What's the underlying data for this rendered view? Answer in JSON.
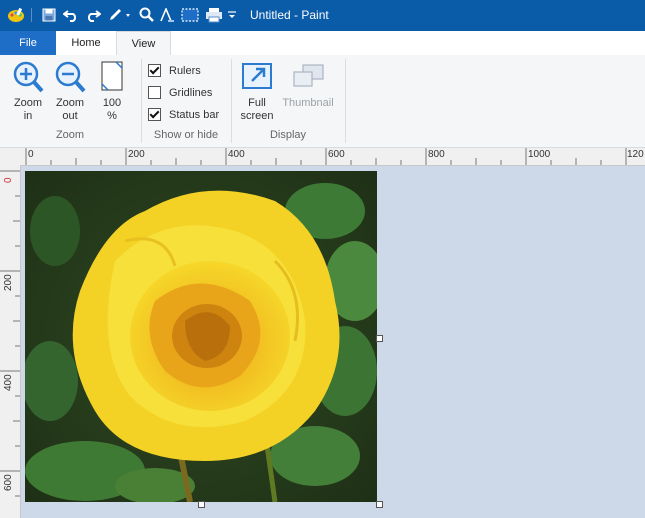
{
  "window": {
    "title": "Untitled - Paint"
  },
  "quick_access": {
    "icons": [
      "paint-app-icon",
      "save-icon",
      "undo-icon",
      "redo-icon",
      "pencil-icon",
      "magnifier-icon",
      "text-icon",
      "select-icon",
      "print-icon",
      "customize-dropdown-icon"
    ]
  },
  "tabs": {
    "file": "File",
    "home": "Home",
    "view": "View"
  },
  "ribbon": {
    "zoom": {
      "zoom_in": "Zoom\nin",
      "zoom_out": "Zoom\nout",
      "percent": "100\n%",
      "group_label": "Zoom"
    },
    "show_hide": {
      "rulers": "Rulers",
      "rulers_checked": true,
      "gridlines": "Gridlines",
      "gridlines_checked": false,
      "status_bar": "Status bar",
      "status_bar_checked": true,
      "group_label": "Show or hide"
    },
    "display": {
      "full_screen": "Full\nscreen",
      "thumbnail": "Thumbnail",
      "group_label": "Display"
    }
  },
  "ruler": {
    "horizontal_labels": [
      "0",
      "200",
      "400",
      "600",
      "800",
      "1000",
      "120"
    ],
    "vertical_labels": [
      "0",
      "200",
      "400",
      "600"
    ]
  },
  "canvas": {
    "image": "yellow rose photo"
  },
  "colors": {
    "titlebar": "#0a5ba8",
    "file_tab": "#1e6ec8",
    "workspace": "#cdd9e8"
  }
}
